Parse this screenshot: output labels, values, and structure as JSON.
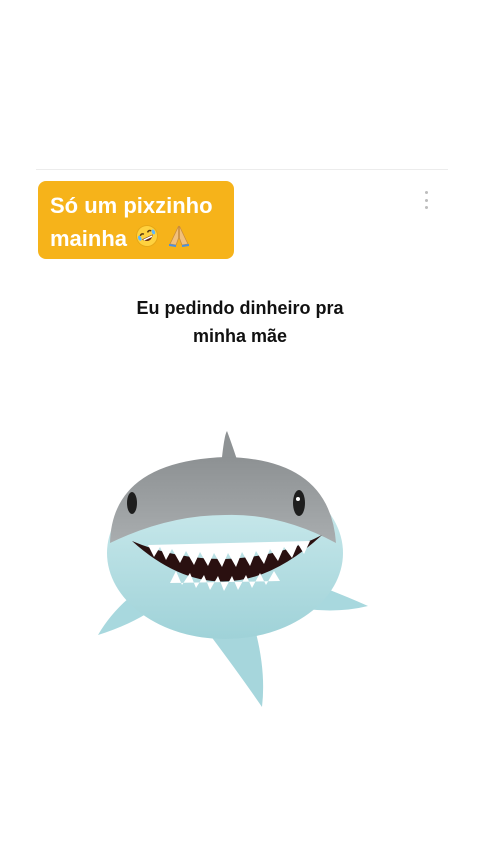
{
  "caption": {
    "line1": "Só um pixzinho",
    "line2": "mainha",
    "emojis": [
      "rolling-on-floor-laughing-icon",
      "folded-hands-icon"
    ],
    "background_color": "#f6b31a",
    "text_color": "#ffffff"
  },
  "menu": {
    "icon": "more-vertical-icon"
  },
  "meme": {
    "line1": "Eu pedindo dinheiro pra",
    "line2": "minha mãe"
  },
  "image": {
    "subject": "shark-animoji-icon"
  }
}
